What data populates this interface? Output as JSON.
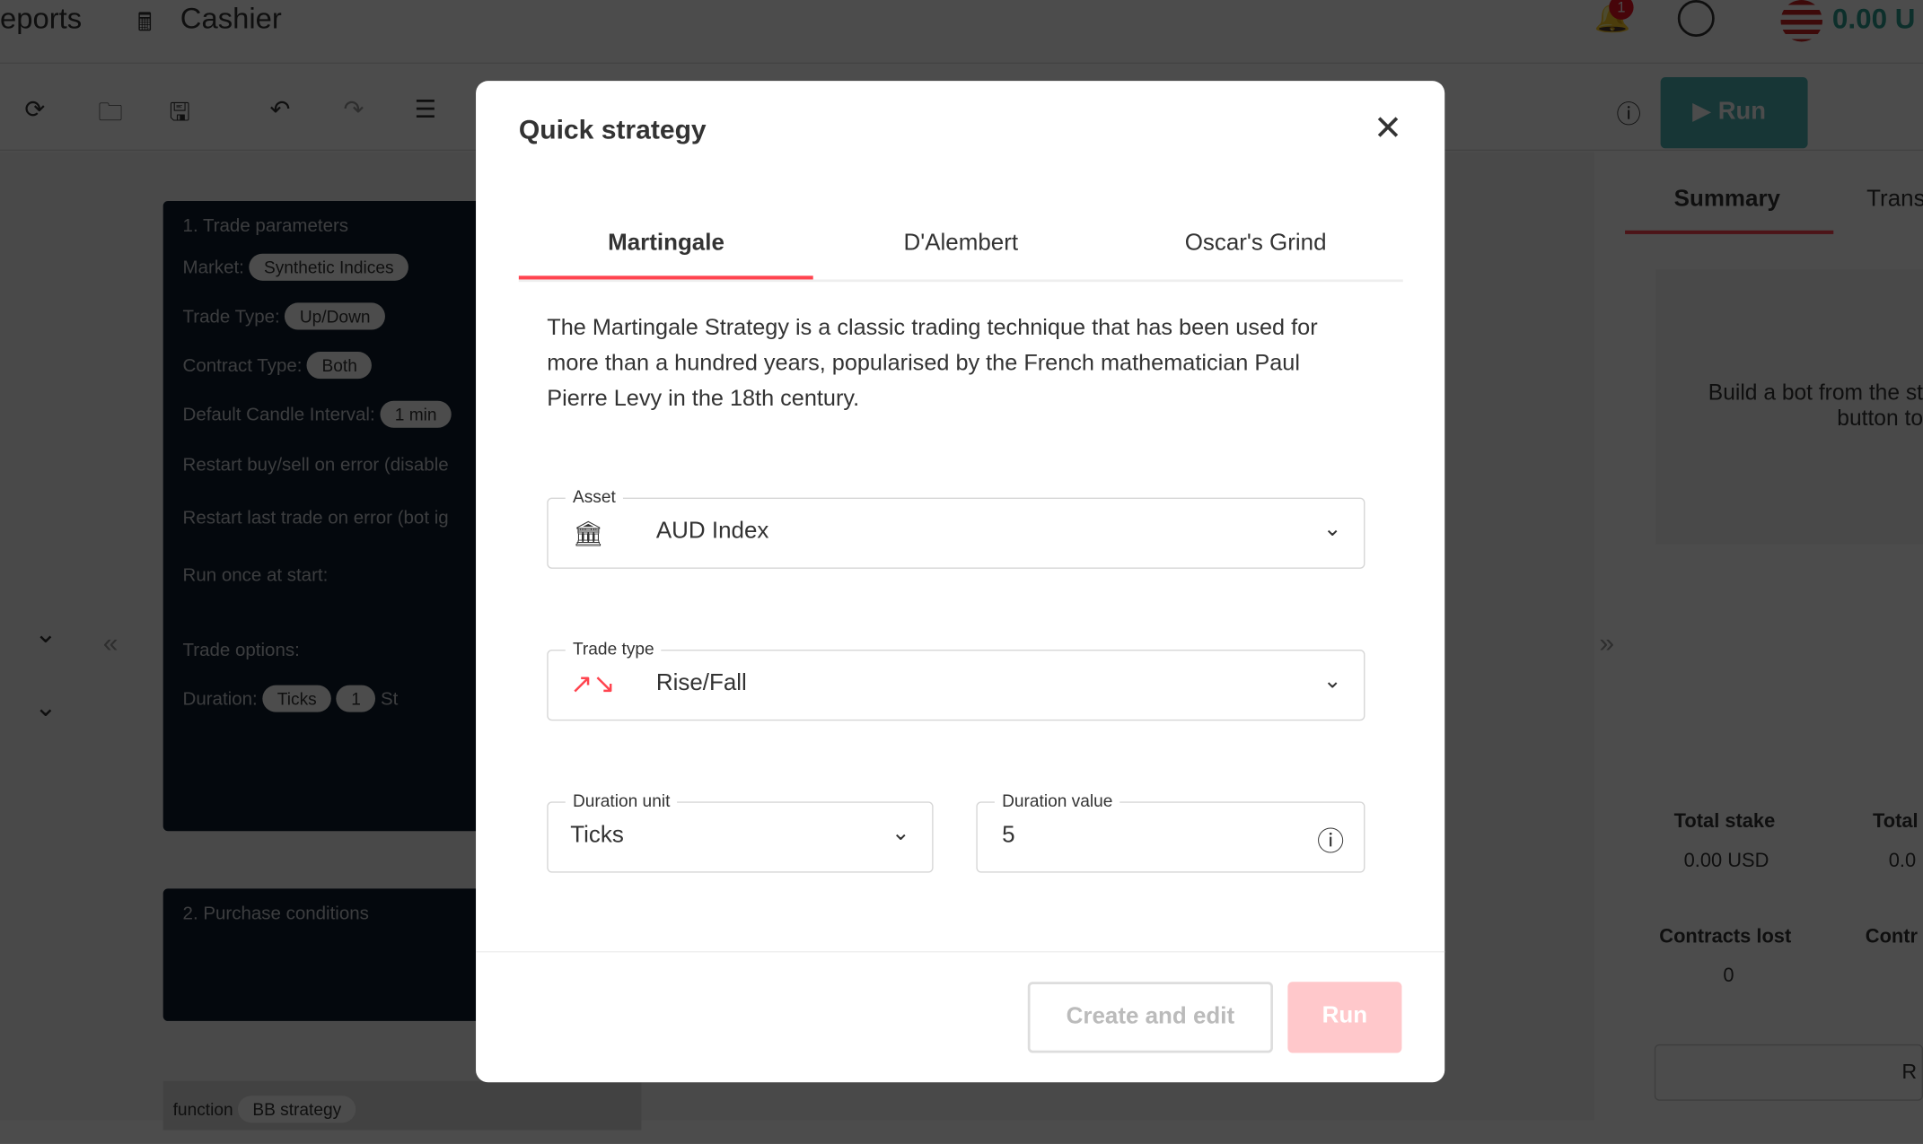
{
  "header": {
    "nav_reports": "eports",
    "nav_cashier": "Cashier",
    "notification_count": "1",
    "balance": "0.00 U"
  },
  "toolbar": {
    "run_label": "Run"
  },
  "workspace": {
    "block1": {
      "title": "1. Trade parameters",
      "market_label": "Market:",
      "market_value": "Synthetic Indices",
      "trade_type_label": "Trade Type:",
      "trade_type_value": "Up/Down",
      "contract_type_label": "Contract Type:",
      "contract_type_value": "Both",
      "candle_label": "Default Candle Interval:",
      "candle_value": "1 min",
      "restart_buy": "Restart buy/sell on error (disable",
      "restart_last": "Restart last trade on error (bot ig",
      "run_once": "Run once at start:",
      "trade_options": "Trade options:",
      "duration_label": "Duration:",
      "duration_unit": "Ticks",
      "duration_value": "1",
      "stake_partial": "St"
    },
    "block2": {
      "title": "2. Purchase conditions"
    },
    "function_label": "function",
    "function_name": "BB strategy"
  },
  "right_panel": {
    "tab_summary": "Summary",
    "tab_transactions": "Trans",
    "empty_line1": "Build a bot from the st",
    "empty_line2": "button to",
    "total_stake_label": "Total stake",
    "total_stake_value": "0.00 USD",
    "total_payout_label": "Total",
    "total_payout_value": "0.0",
    "contracts_lost_label": "Contracts lost",
    "contracts_lost_value": "0",
    "contracts_won_label": "Contr",
    "reset_label": "R"
  },
  "modal": {
    "title": "Quick strategy",
    "tabs": [
      {
        "label": "Martingale",
        "active": true
      },
      {
        "label": "D'Alembert"
      },
      {
        "label": "Oscar's Grind"
      }
    ],
    "description": "The Martingale Strategy is a classic trading technique that has been used for more than a hundred years, popularised by the French mathematician Paul Pierre Levy in the 18th century.",
    "asset": {
      "label": "Asset",
      "value": "AUD Index"
    },
    "trade_type": {
      "label": "Trade type",
      "value": "Rise/Fall"
    },
    "duration_unit": {
      "label": "Duration unit",
      "value": "Ticks"
    },
    "duration_value": {
      "label": "Duration value",
      "value": "5"
    },
    "create_edit_label": "Create and edit",
    "run_label": "Run"
  },
  "colors": {
    "accent": "#ff444f",
    "run_green": "#4bb4b3",
    "disabled_run": "#ffb0b5"
  }
}
